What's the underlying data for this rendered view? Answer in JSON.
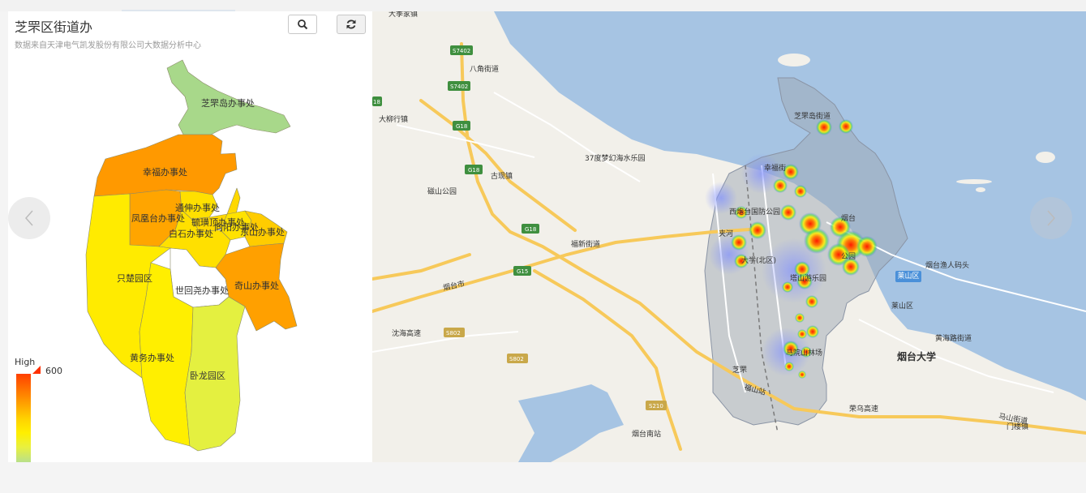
{
  "panel": {
    "title": "芝罘区街道办",
    "subtitle": "数据来自天津电气凯发股份有限公司大数据分析中心",
    "search_icon": "search-icon",
    "refresh_icon": "refresh-icon"
  },
  "districts": [
    {
      "id": "zhifudao",
      "label": "芝罘岛办事处",
      "color": "#a8d88a"
    },
    {
      "id": "xingfu",
      "label": "幸福办事处",
      "color": "#ff9900"
    },
    {
      "id": "fenghuangtai",
      "label": "凤凰台办事处",
      "color": "#ffa500"
    },
    {
      "id": "tongshen",
      "label": "通伸办事处",
      "color": "#ffe000"
    },
    {
      "id": "yuhuangding",
      "label": "毓璜顶办事处",
      "color": "#ffd800"
    },
    {
      "id": "xiangyang",
      "label": "向阳办事处",
      "color": "#ffe200"
    },
    {
      "id": "dongshan",
      "label": "东山办事处",
      "color": "#ffcc00"
    },
    {
      "id": "baishi",
      "label": "白石办事处",
      "color": "#ffe000"
    },
    {
      "id": "zhichuyuan",
      "label": "只楚园区",
      "color": "#ffeb00"
    },
    {
      "id": "shihuiyuan",
      "label": "世回尧办事处",
      "color": "#ffffff"
    },
    {
      "id": "qishan",
      "label": "奇山办事处",
      "color": "#ffa000"
    },
    {
      "id": "huangwu",
      "label": "黄务办事处",
      "color": "#ffef00"
    },
    {
      "id": "wolong",
      "label": "卧龙园区",
      "color": "#e4f040"
    }
  ],
  "legend": {
    "high_label": "High",
    "max_value": "600",
    "colors": [
      "#ff4000",
      "#ff7000",
      "#ffa000",
      "#ffd000",
      "#ffef00",
      "#e8f040",
      "#b8e08a"
    ]
  },
  "map": {
    "water_color": "#a6c4e3",
    "land_color": "#f2f0ea",
    "labels": [
      {
        "text": "大季家镇"
      },
      {
        "text": "八角街道"
      },
      {
        "text": "大柳行镇"
      },
      {
        "text": "古现镇"
      },
      {
        "text": "37度梦幻海水乐园"
      },
      {
        "text": "磁山公园"
      },
      {
        "text": "芝罘岛街道"
      },
      {
        "text": "幸福街"
      },
      {
        "text": "西炮台国防公园"
      },
      {
        "text": "烟台"
      },
      {
        "text": "福新街道"
      },
      {
        "text": "夹河"
      },
      {
        "text": "大学(北区)"
      },
      {
        "text": "塔山游乐园"
      },
      {
        "text": "公园"
      },
      {
        "text": "烟台渔人码头"
      },
      {
        "text": "莱山区"
      },
      {
        "text": "黄海路街道"
      },
      {
        "text": "烟台大学"
      },
      {
        "text": "烟台市"
      },
      {
        "text": "沈海高速"
      },
      {
        "text": "马院山林场"
      },
      {
        "text": "芝罘"
      },
      {
        "text": "福山站"
      },
      {
        "text": "荣乌高速"
      },
      {
        "text": "烟台南站"
      },
      {
        "text": "门楼镇"
      },
      {
        "text": "马山街道"
      },
      {
        "text": "荣乌高速"
      }
    ],
    "road_shields": [
      {
        "text": "S7402"
      },
      {
        "text": "S7402"
      },
      {
        "text": "G18"
      },
      {
        "text": "G18"
      },
      {
        "text": "G18"
      },
      {
        "text": "G15"
      },
      {
        "text": "S802"
      },
      {
        "text": "S802"
      },
      {
        "text": "S210"
      },
      {
        "text": "18"
      }
    ]
  },
  "nav": {
    "prev_icon": "chevron-left-icon",
    "next_icon": "chevron-right-icon"
  }
}
